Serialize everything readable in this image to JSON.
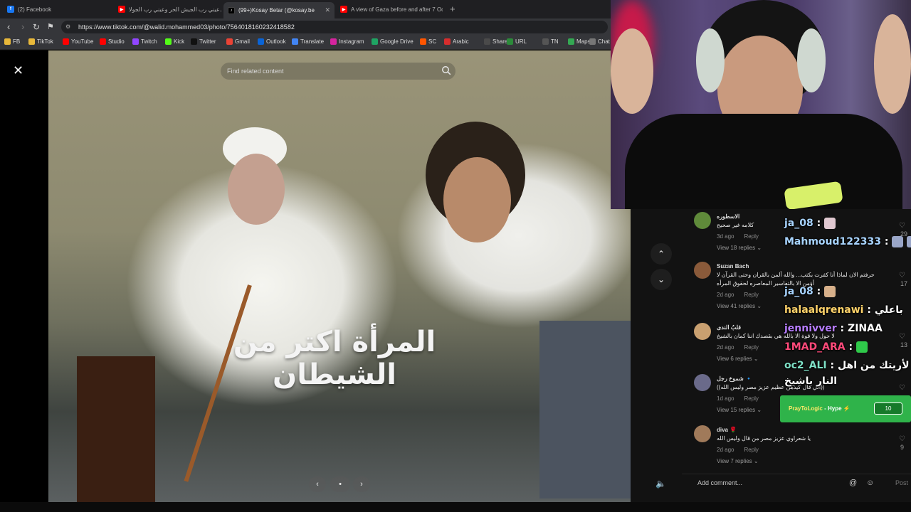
{
  "tabs": [
    {
      "title": "(2) Facebook",
      "icon_color": "#1877f2",
      "icon_char": "f"
    },
    {
      "title": "عيني رب الجيش الحر وعيني رب الجولا...",
      "icon_color": "#ff0000",
      "icon_char": "▶"
    },
    {
      "title": "(99+)Kosay Betar (@kosay.be",
      "icon_color": "#000000",
      "icon_char": "♪",
      "active": true
    },
    {
      "title": "A view of Gaza before and after 7 Oc",
      "icon_color": "#ff0000",
      "icon_char": "▶"
    }
  ],
  "address": {
    "url": "https://www.tiktok.com/@walid.mohammed03/photo/7564018160232418582"
  },
  "bookmarks": [
    {
      "label": "FB",
      "color": "#e8b83a"
    },
    {
      "label": "TikTok",
      "color": "#e8b83a"
    },
    {
      "label": "YouTube",
      "color": "#ff0000"
    },
    {
      "label": "Studio",
      "color": "#ff0000"
    },
    {
      "label": "Twitch",
      "color": "#9146ff"
    },
    {
      "label": "Kick",
      "color": "#53fc18"
    },
    {
      "label": "Twitter",
      "color": "#111111"
    },
    {
      "label": "Gmail",
      "color": "#ea4335"
    },
    {
      "label": "Outlook",
      "color": "#0a64d6"
    },
    {
      "label": "Translate",
      "color": "#4285f4"
    },
    {
      "label": "Instagram",
      "color": "#d6249f"
    },
    {
      "label": "Google Drive",
      "color": "#1fa463"
    },
    {
      "label": "SC",
      "color": "#ff5500"
    },
    {
      "label": "Arabic",
      "color": "#d62d2d"
    },
    {
      "label": "Share",
      "color": "#4a4a4a"
    },
    {
      "label": "URL",
      "color": "#2c8a3a"
    },
    {
      "label": "TN",
      "color": "#555555"
    },
    {
      "label": "Maps",
      "color": "#34a853"
    },
    {
      "label": "Chat",
      "color": "#777777"
    }
  ],
  "tiktok": {
    "search_placeholder": "Find related content",
    "caption": "المرأة اكتر من الشيطان"
  },
  "comments": [
    {
      "name": "الاسطوره",
      "text": "كلامه غير صحيح",
      "time": "3d ago",
      "reply": "Reply",
      "view": "View 18 replies ⌄",
      "likes": "29",
      "avatar_color": "#5f8a3a"
    },
    {
      "name": "Suzan Bach",
      "text": "حرفتم الان لماذا أنا كفرت بكتب... والله ألمن بالقران وحتى القرآن لا",
      "text2": "أؤمن الا بالتفاسير المعاصره لحقوق المرأه",
      "time": "2d ago",
      "reply": "Reply",
      "view": "View 41 replies ⌄",
      "likes": "17",
      "avatar_color": "#8a5a3a"
    },
    {
      "name": "قلبُ الندى",
      "text": "لا حول ولا قوة الا بالله هي بقصدك اننا كمان بالشيخ",
      "time": "2d ago",
      "reply": "Reply",
      "view": "View 6 replies ⌄",
      "likes": "13",
      "avatar_color": "#c9a070"
    },
    {
      "name": "شموخ رجل 🔹",
      "text": "((الي قال كيدهن عظيم عزيز مصر وليس الله))",
      "time": "1d ago",
      "reply": "Reply",
      "view": "View 15 replies ⌄",
      "likes": "",
      "avatar_color": "#6a6a8a"
    },
    {
      "name": "diva 🌹",
      "text": "يا شعراوي عزيز مصر من قال وليس الله",
      "time": "2d ago",
      "reply": "Reply",
      "view": "View 7 replies ⌄",
      "likes": "9",
      "avatar_color": "#a07a5a"
    }
  ],
  "add_comment": {
    "placeholder": "Add comment...",
    "post": "Post"
  },
  "stream_chat": [
    {
      "user": "ja_08",
      "sep": " : ",
      "msg": "",
      "color": "#a8d4ff"
    },
    {
      "user": "Mahmoud122333",
      "sep": " : ",
      "msg": "",
      "color": "#a8d4ff"
    },
    {
      "user": "ja_08",
      "sep": " : ",
      "msg": "",
      "color": "#a8d4ff"
    },
    {
      "user": "halaalqrenawi",
      "sep": " : ",
      "msg": "باعلي",
      "color": "#ffd36a"
    },
    {
      "user": "jennivver",
      "sep": " : ",
      "msg": "ZINAA",
      "color": "#b77dff"
    },
    {
      "user": "1MAD_ARA",
      "sep": " : ",
      "msg": "",
      "color": "#ff4a7a"
    },
    {
      "user": "oc2_ALI",
      "sep": " : ",
      "msg": "والله اني لأريتك من اهل",
      "color": "#7ee0c6"
    },
    {
      "user": "",
      "sep": "",
      "msg": "النار باشيخ",
      "color": "#ffffff"
    }
  ],
  "hype": {
    "label": "PrayToLogic",
    "suffix": " - Hype",
    "count": "10"
  },
  "colors": {
    "tiktok_bg": "#000000",
    "panel_bg": "#121212",
    "hype_green": "#2fb34a"
  }
}
